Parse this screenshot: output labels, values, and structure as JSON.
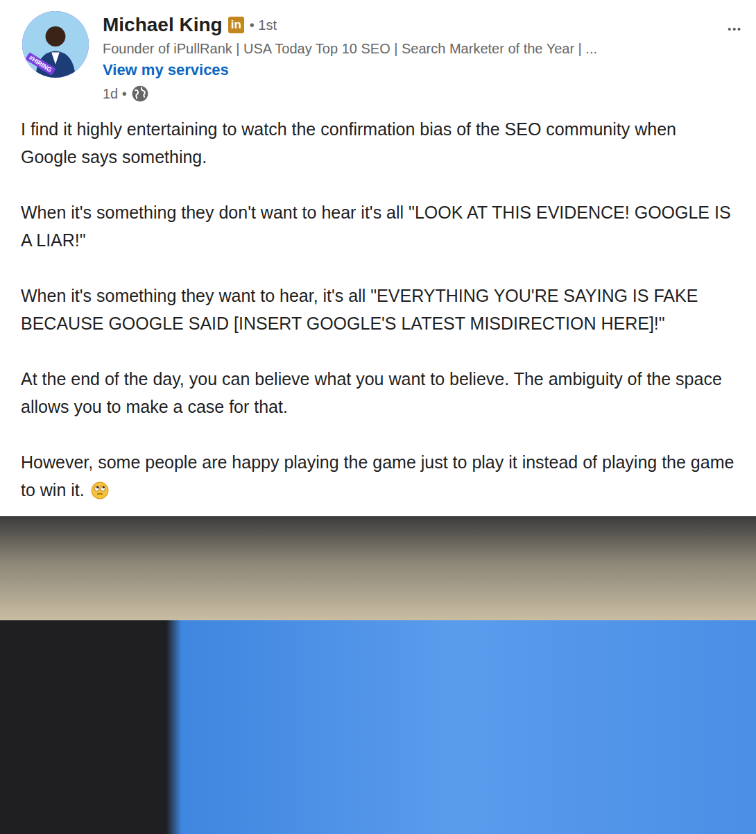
{
  "author": {
    "name": "Michael King",
    "badge": "in",
    "connection": "• 1st",
    "avatar_badge": "#HIRING",
    "headline": "Founder of iPullRank | USA Today Top 10 SEO | Search Marketer of the Year | ...",
    "services_link": "View my services",
    "time": "1d •"
  },
  "menu": "•••",
  "paragraphs": [
    "I find it highly entertaining to watch the confirmation bias of the SEO community when Google says something.",
    "When it's something they don't want to hear it's all \"LOOK AT THIS EVIDENCE! GOOGLE IS A LIAR!\"",
    "When it's something they want to hear, it's all \"EVERYTHING YOU'RE SAYING IS FAKE BECAUSE GOOGLE SAID [INSERT GOOGLE'S LATEST MISDIRECTION HERE]!\"",
    "At the end of the day, you can believe what you want to believe. The ambiguity of the space allows you to make a case for that.",
    "However, some people are happy playing the game just to play it instead of playing the game to win it."
  ]
}
